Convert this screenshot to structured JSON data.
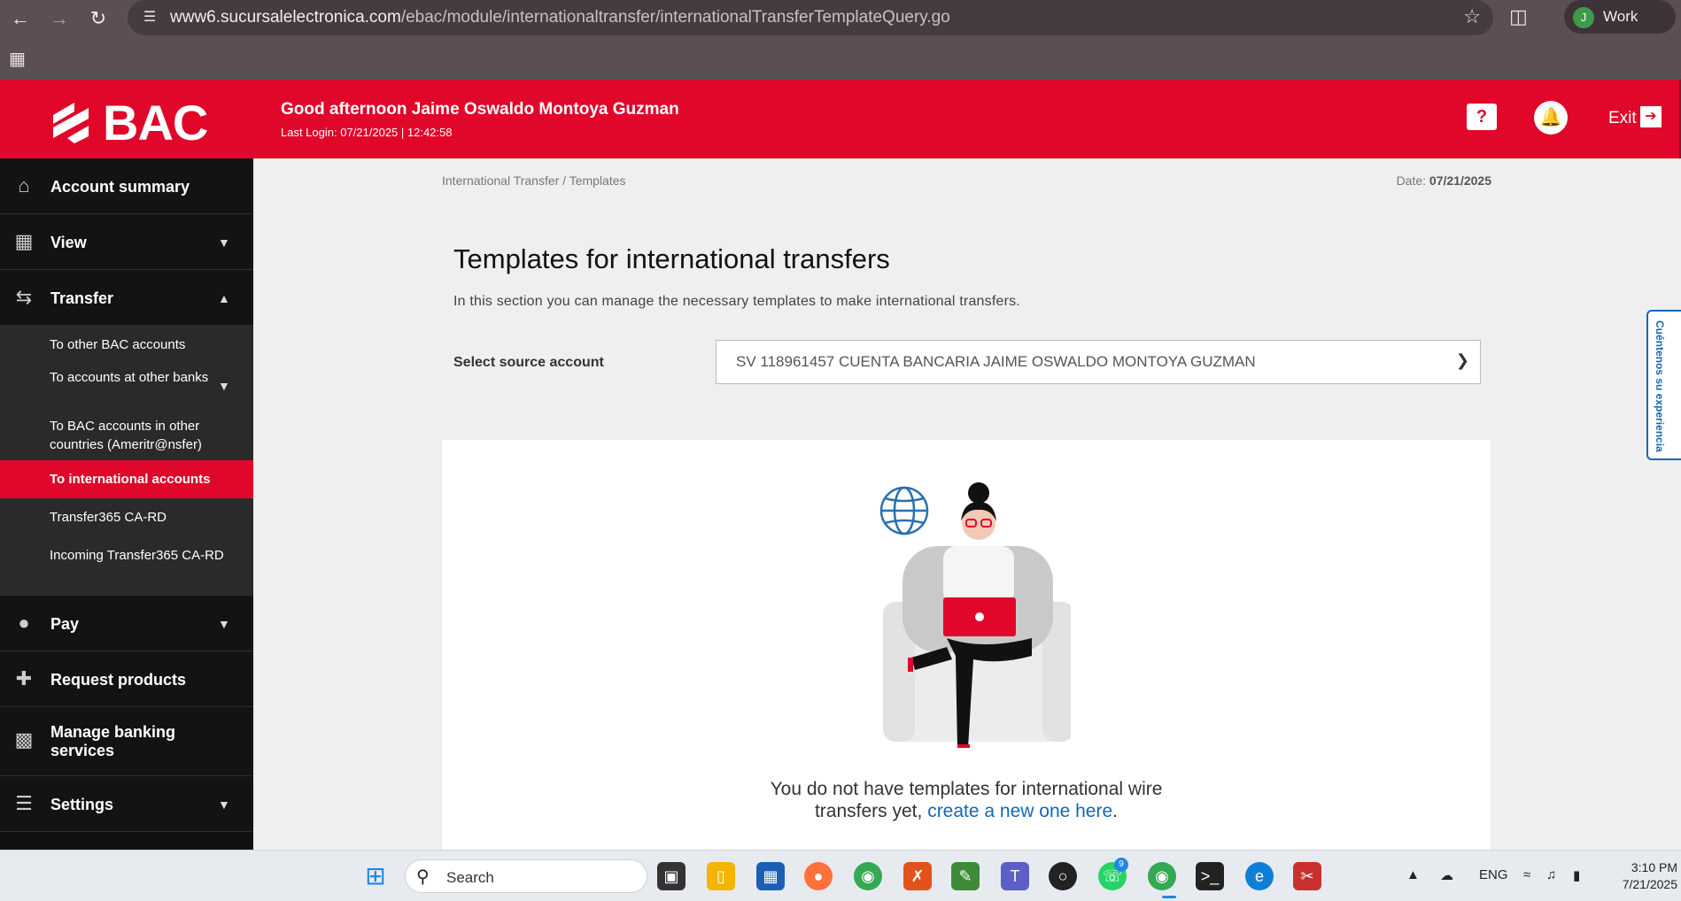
{
  "browser": {
    "url_host": "www6.sucursalelectronica.com",
    "url_path": "/ebac/module/internationaltransfer/internationalTransferTemplateQuery.go",
    "profile_initial": "J",
    "profile_name": "Work"
  },
  "header": {
    "logo_text": "BAC",
    "greeting": "Good afternoon Jaime Oswaldo Montoya Guzman",
    "last_login": "Last Login:  07/21/2025 | 12:42:58",
    "help_symbol": "?",
    "exit_label": "Exit"
  },
  "sidebar": {
    "account_summary": "Account summary",
    "view": "View",
    "transfer": "Transfer",
    "transfer_items": [
      "To other BAC accounts",
      "To accounts at other banks",
      "To BAC accounts in other countries (Ameritr@nsfer)",
      "To international accounts",
      "Transfer365 CA-RD",
      "Incoming Transfer365 CA-RD"
    ],
    "pay": "Pay",
    "request_products": "Request products",
    "manage_banking": "Manage banking services",
    "settings": "Settings"
  },
  "main": {
    "breadcrumb": "International Transfer / Templates",
    "date_label": "Date: ",
    "date_value": "07/21/2025",
    "title": "Templates for international transfers",
    "description": "In this section you can manage the necessary templates to make international transfers.",
    "select_label": "Select source account",
    "select_value": "SV 118961457 CUENTA BANCARIA JAIME OSWALDO MONTOYA GUZMAN",
    "empty_line1": "You do not have templates for international wire",
    "empty_line2": "transfers yet, ",
    "empty_link": "create a new one here",
    "empty_end": "."
  },
  "feedback_tab": "Cuéntenos su experiencia",
  "taskbar": {
    "search_placeholder": "Search",
    "whatsapp_badge": "9",
    "language": "ENG",
    "time": "3:10 PM",
    "date": "7/21/2025"
  },
  "colors": {
    "brand_red": "#e1072a",
    "sidebar_dark": "#131313",
    "link_blue": "#1567b5"
  }
}
